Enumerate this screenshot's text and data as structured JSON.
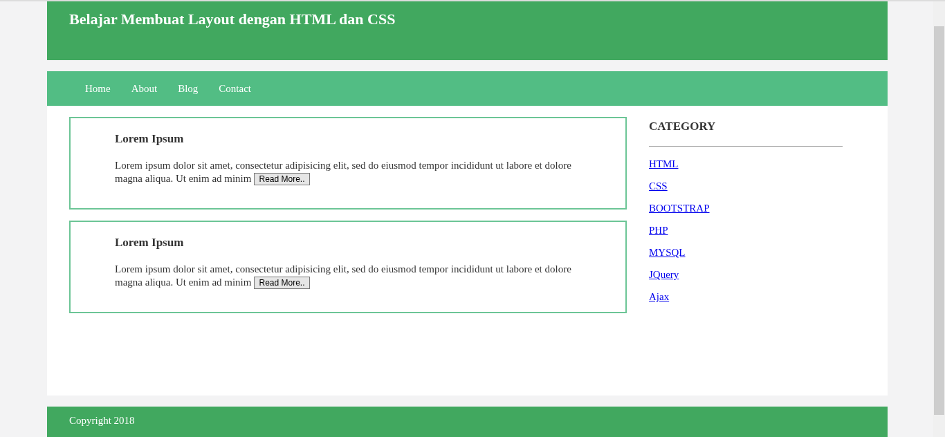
{
  "header": {
    "title": "Belajar Membuat Layout dengan HTML dan CSS"
  },
  "nav": {
    "items": [
      {
        "label": "Home"
      },
      {
        "label": "About"
      },
      {
        "label": "Blog"
      },
      {
        "label": "Contact"
      }
    ]
  },
  "articles": [
    {
      "title": "Lorem Ipsum",
      "text": "Lorem ipsum dolor sit amet, consectetur adipisicing elit, sed do eiusmod tempor incididunt ut labore et dolore magna aliqua. Ut enim ad minim",
      "button": "Read More.."
    },
    {
      "title": "Lorem Ipsum",
      "text": "Lorem ipsum dolor sit amet, consectetur adipisicing elit, sed do eiusmod tempor incididunt ut labore et dolore magna aliqua. Ut enim ad minim",
      "button": "Read More.."
    }
  ],
  "sidebar": {
    "title": "CATEGORY",
    "links": [
      {
        "label": "HTML"
      },
      {
        "label": "CSS"
      },
      {
        "label": "BOOTSTRAP"
      },
      {
        "label": "PHP"
      },
      {
        "label": "MYSQL"
      },
      {
        "label": "JQuery"
      },
      {
        "label": "Ajax"
      }
    ]
  },
  "footer": {
    "text": "Copyright 2018"
  }
}
